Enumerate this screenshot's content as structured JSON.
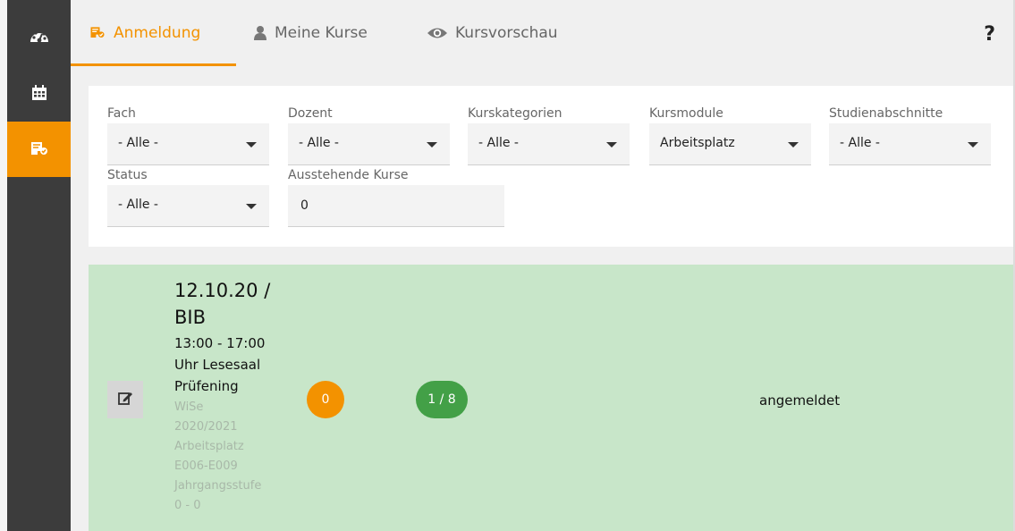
{
  "colors": {
    "accent": "#f39200",
    "sidebar": "#3c3c3c",
    "course_bg": "#c8e6c9",
    "badge_green": "#43a047"
  },
  "sidebar": {
    "items": [
      {
        "icon": "dashboard-gauge-icon"
      },
      {
        "icon": "calendar-icon"
      },
      {
        "icon": "registration-icon",
        "active": true
      }
    ]
  },
  "tabs": [
    {
      "label": "Anmeldung",
      "icon": "registration-icon",
      "active": true
    },
    {
      "label": "Meine Kurse",
      "icon": "user-icon"
    },
    {
      "label": "Kursvorschau",
      "icon": "eye-icon"
    }
  ],
  "help_label": "?",
  "filters": {
    "fach": {
      "label": "Fach",
      "value": "- Alle -"
    },
    "dozent": {
      "label": "Dozent",
      "value": "- Alle -"
    },
    "kurskategorien": {
      "label": "Kurskategorien",
      "value": "- Alle -"
    },
    "kursmodule": {
      "label": "Kursmodule",
      "value": "Arbeitsplatz"
    },
    "studienabschnitte": {
      "label": "Studienabschnitte",
      "value": "- Alle -"
    },
    "status": {
      "label": "Status",
      "value": "- Alle -"
    },
    "ausstehende": {
      "label": "Ausstehende Kurse",
      "value": "0"
    }
  },
  "course": {
    "title_line1": "12.10.20 /",
    "title_line2": "BIB",
    "time": "13:00 - 17:00",
    "place_line1": "Uhr Lesesaal",
    "place_line2": "Prüfening",
    "sub_lines": [
      "WiSe",
      "2020/2021",
      "Arbeitsplatz",
      "E006-E009",
      "Jahrgangsstufe",
      "0 - 0"
    ],
    "badge_pending": "0",
    "badge_slots": "1 / 8",
    "status": "angemeldet"
  }
}
